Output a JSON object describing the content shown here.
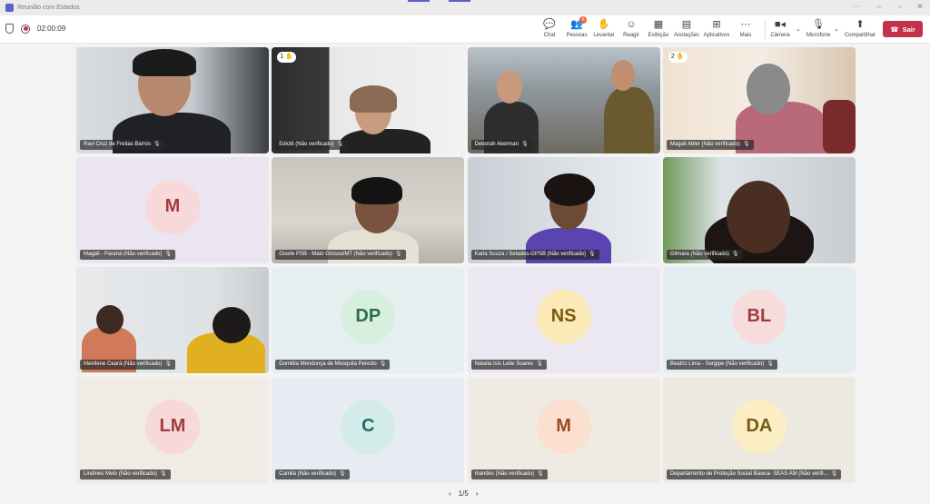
{
  "window": {
    "title": "Reunião com Estados"
  },
  "toolbar": {
    "timer": "02:00:09",
    "buttons": [
      {
        "label": "Chat",
        "icon": "chat-icon"
      },
      {
        "label": "Pessoas",
        "icon": "people-icon",
        "badge": "6"
      },
      {
        "label": "Levantar",
        "icon": "raise-hand-icon"
      },
      {
        "label": "Reagir",
        "icon": "react-icon"
      },
      {
        "label": "Exibição",
        "icon": "view-icon"
      },
      {
        "label": "Anotações",
        "icon": "notes-icon"
      },
      {
        "label": "Aplicativos",
        "icon": "apps-icon"
      },
      {
        "label": "Mais",
        "icon": "more-icon"
      },
      {
        "label": "Câmera",
        "icon": "camera-icon"
      },
      {
        "label": "Microfone",
        "icon": "mic-off-icon"
      },
      {
        "label": "Compartilhar",
        "icon": "share-icon"
      }
    ],
    "leave_label": "Sair"
  },
  "participants": [
    {
      "name": "Ravi Cruz de Freitas Barros",
      "type": "video"
    },
    {
      "name": "Ediclê (Não verificado)",
      "type": "video",
      "hand": "1",
      "highlight": "blue"
    },
    {
      "name": "Deborah Akerman",
      "type": "video"
    },
    {
      "name": "Magali Abler (Não verificado)",
      "type": "video",
      "hand": "2",
      "highlight": "gold"
    },
    {
      "name": "Magali - Paraná (Não verificado)",
      "type": "avatar",
      "initials": "M",
      "bg": "#e9e2f0",
      "circle": "#f8d9d9",
      "fg": "#a03c3c"
    },
    {
      "name": "Gisele PSB - Mato Grosso/MT (Não verificado)",
      "type": "video"
    },
    {
      "name": "Karla Souza / Setades-GPSB (Não verificado)",
      "type": "video"
    },
    {
      "name": "Gilmara (Não verificado)",
      "type": "video"
    },
    {
      "name": "Meirilene Ceará (Não verificado)",
      "type": "video"
    },
    {
      "name": "Domitila Mendonça de Mesquita Peixoto",
      "type": "avatar",
      "initials": "DP",
      "bg": "#e6f0f0",
      "circle": "#d6efdf",
      "fg": "#2f6e45"
    },
    {
      "name": "Natalia Isis Leite Soares",
      "type": "avatar",
      "initials": "NS",
      "bg": "#ece8f2",
      "circle": "#fbe9b8",
      "fg": "#7a5a10"
    },
    {
      "name": "Beatriz Lima - Sergipe (Não verificado)",
      "type": "avatar",
      "initials": "BL",
      "bg": "#e5eff0",
      "circle": "#f8dcdc",
      "fg": "#a03c3c"
    },
    {
      "name": "Lindines Melo (Não verificado)",
      "type": "avatar",
      "initials": "LM",
      "bg": "#f1ebe4",
      "circle": "#f8d9d9",
      "fg": "#a03c3c"
    },
    {
      "name": "Camila (Não verificado)",
      "type": "avatar",
      "initials": "C",
      "bg": "#e6ecf2",
      "circle": "#d3ecea",
      "fg": "#216b67"
    },
    {
      "name": "mandes (Não verificado)",
      "type": "avatar",
      "initials": "M",
      "bg": "#efebe2",
      "circle": "#fbe0cf",
      "fg": "#9a4b1f"
    },
    {
      "name": "Departamento de Proteção Social Básica- SEAS AM (Não verifi...",
      "type": "avatar",
      "initials": "DA",
      "bg": "#ece9e0",
      "circle": "#fbedc4",
      "fg": "#7a5a10"
    }
  ],
  "pager": {
    "label": "1/5"
  }
}
